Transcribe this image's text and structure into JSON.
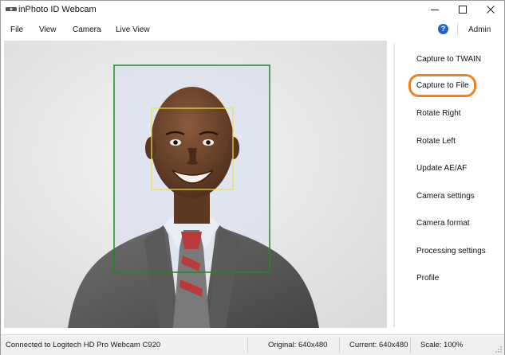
{
  "window": {
    "title": "inPhoto ID Webcam",
    "icons": [
      "app-icon",
      "minimize-icon",
      "maximize-icon",
      "close-icon"
    ]
  },
  "menu": {
    "items": [
      "File",
      "View",
      "Camera",
      "Live View"
    ],
    "help_icon": "help-icon",
    "admin_label": "Admin"
  },
  "sidebar": {
    "buttons": [
      "Capture to TWAIN",
      "Capture to File",
      "Rotate Right",
      "Rotate Left",
      "Update AE/AF",
      "Camera settings",
      "Camera format",
      "Processing settings",
      "Profile"
    ],
    "highlighted": "Capture to File",
    "highlight_color": "#f08123"
  },
  "viewport": {
    "face_frame_color": "#1f8a1f",
    "face_box_color": "#e9e24a"
  },
  "status": {
    "connection": "Connected to Logitech HD Pro Webcam C920",
    "original": "Original: 640x480",
    "current": "Current: 640x480",
    "scale": "Scale: 100%"
  }
}
